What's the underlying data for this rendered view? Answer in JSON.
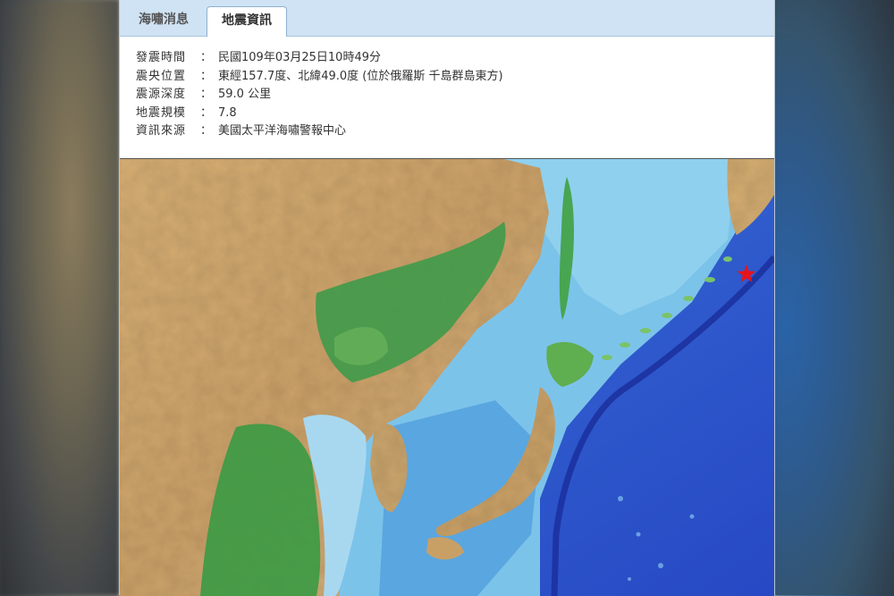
{
  "tabs": [
    {
      "label": "海嘯消息"
    },
    {
      "label": "地震資訊"
    }
  ],
  "earthquake": {
    "rows": [
      {
        "label": "發震時間",
        "colon": "：",
        "value": "民國109年03月25日10時49分"
      },
      {
        "label": "震央位置",
        "colon": "：",
        "value": "東經157.7度、北緯49.0度 (位於俄羅斯 千島群島東方)"
      },
      {
        "label": "震源深度",
        "colon": "：",
        "value": "59.0 公里"
      },
      {
        "label": "地震規模",
        "colon": "：",
        "value": "7.8"
      },
      {
        "label": "資訊來源",
        "colon": "：",
        "value": "美國太平洋海嘯警報中心"
      }
    ]
  },
  "map": {
    "epicenter_marker": "red-star",
    "colors": {
      "land_high": "#d9b27a",
      "land_low": "#3f9a4a",
      "shallow_sea": "#a8d8f0",
      "deep_sea": "#2a55c8",
      "trench": "#1b2f9e",
      "marker": "#e8131b"
    }
  }
}
